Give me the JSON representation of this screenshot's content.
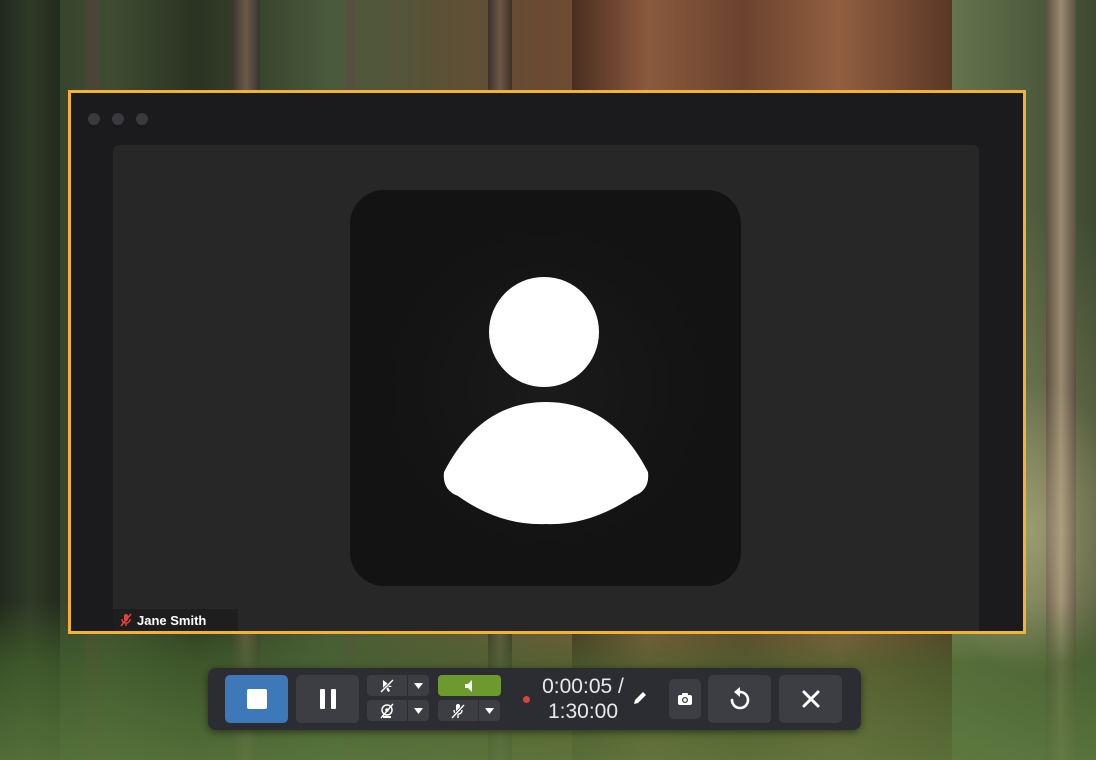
{
  "window": {
    "title_dots": [
      "close",
      "minimize",
      "zoom"
    ]
  },
  "participant": {
    "name": "Jane Smith",
    "mic_status_icon": "mic-muted-icon",
    "avatar_icon": "person-icon"
  },
  "toolbar": {
    "stop_icon": "stop-icon",
    "pause_icon": "pause-icon",
    "camera_toggle_icon": "cursor-off-icon",
    "webcam_toggle_icon": "webcam-off-icon",
    "speaker_icon": "speaker-icon",
    "mic_toggle_icon": "mic-off-icon",
    "elapsed": "0:00:05",
    "separator": "/",
    "duration": "1:30:00",
    "edit_icon": "pencil-icon",
    "screenshot_icon": "camera-icon",
    "restart_icon": "restart-icon",
    "close_icon": "close-icon"
  },
  "colors": {
    "window_border": "#f2b233",
    "stop_button": "#3d78b8",
    "speaker_active": "#6d9a2f",
    "record_dot": "#d9443a"
  }
}
